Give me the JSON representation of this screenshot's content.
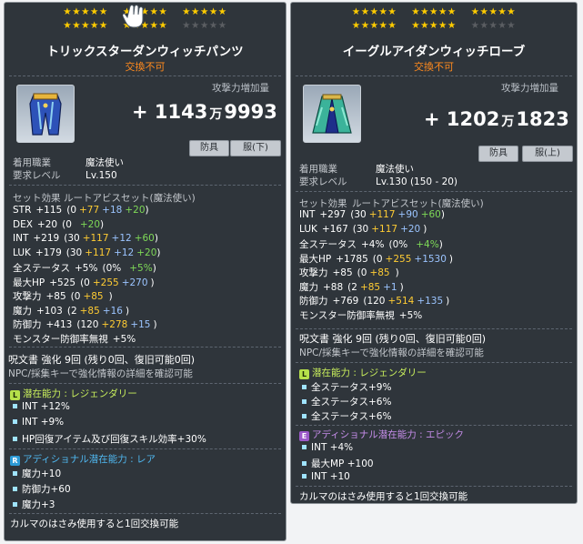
{
  "left": {
    "stars": {
      "row1": [
        "★★★★★",
        "★★★★★",
        "★★★★★"
      ],
      "row2": [
        "★★★★★",
        "★★★★★",
        "★★★★★"
      ]
    },
    "title": "トリックスターダンウィッチパンツ",
    "trade": "交換不可",
    "power_label": "攻撃力増加量",
    "power_prefix": "+ 1143",
    "power_unit": "万",
    "power_rest": "9993",
    "tags": [
      "防具",
      "服(下)"
    ],
    "job_label": "着用職業",
    "job_value": "魔法使い",
    "level_label": "要求レベル",
    "level_value": "Lv.150",
    "set_label": "セット効果",
    "set_value": "ルートアビスセット(魔法使い)",
    "stats": [
      {
        "k": "STR",
        "v": "+115",
        "base": "(0",
        "a": "+77",
        "b": "+18",
        "c": "+20",
        "end": ")"
      },
      {
        "k": "DEX",
        "v": "+20",
        "base": "(0",
        "a": "",
        "b": "",
        "c": "+20",
        "end": ")"
      },
      {
        "k": "INT",
        "v": "+219",
        "base": "(30",
        "a": "+117",
        "b": "+12",
        "c": "+60",
        "end": ")"
      },
      {
        "k": "LUK",
        "v": "+179",
        "base": "(30",
        "a": "+117",
        "b": "+12",
        "c": "+20",
        "end": ")"
      },
      {
        "k": "全ステータス",
        "v": "+5%",
        "base": "(0%",
        "a": "",
        "b": "",
        "c": "+5%",
        "end": ")"
      },
      {
        "k": "最大HP",
        "v": "+525",
        "base": "(0",
        "a": "+255",
        "b": "+270",
        "c": "",
        "end": ")"
      },
      {
        "k": "攻撃力",
        "v": "+85",
        "base": "(0",
        "a": "+85",
        "b": "",
        "c": "",
        "end": ")"
      },
      {
        "k": "魔力",
        "v": "+103",
        "base": "(2",
        "a": "+85",
        "b": "+16",
        "c": "",
        "end": ")"
      },
      {
        "k": "防御力",
        "v": "+413",
        "base": "(120",
        "a": "+278",
        "b": "+15",
        "c": "",
        "end": ")"
      },
      {
        "k": "モンスター防御率無視",
        "v": "+5%",
        "base": "",
        "a": "",
        "b": "",
        "c": "",
        "end": ""
      }
    ],
    "scroll_line": "呪文書 強化 9回 (残り0回、復旧可能0回)",
    "npc_line": "NPC/採集キーで強化情報の詳細を確認可能",
    "pot_head": "潜在能力 : レジェンダリー",
    "pot_icon": "L",
    "pot_lines": [
      "INT +12%",
      "INT +9%",
      "HP回復アイテム及び回復スキル効率+30%"
    ],
    "add_head": "アディショナル潜在能力 : レア",
    "add_icon": "R",
    "add_lines": [
      "魔力+10",
      "防御力+60",
      "魔力+3"
    ],
    "footer": "カルマのはさみ使用すると1回交換可能"
  },
  "right": {
    "stars": {
      "row1": [
        "★★★★★",
        "★★★★★",
        "★★★★★"
      ],
      "row2": [
        "★★★★★",
        "★★★★★",
        "★★★★★"
      ]
    },
    "title": "イーグルアイダンウィッチローブ",
    "trade": "交換不可",
    "power_label": "攻撃力増加量",
    "power_prefix": "+ 1202",
    "power_unit": "万",
    "power_rest": "1823",
    "tags": [
      "防具",
      "服(上)"
    ],
    "job_label": "着用職業",
    "job_value": "魔法使い",
    "level_label": "要求レベル",
    "level_value": "Lv.130 (150 - 20)",
    "set_label": "セット効果",
    "set_value": "ルートアビスセット(魔法使い)",
    "stats": [
      {
        "k": "INT",
        "v": "+297",
        "base": "(30",
        "a": "+117",
        "b": "+90",
        "c": "+60",
        "end": ")"
      },
      {
        "k": "LUK",
        "v": "+167",
        "base": "(30",
        "a": "+117",
        "b": "+20",
        "c": "",
        "end": ")"
      },
      {
        "k": "全ステータス",
        "v": "+4%",
        "base": "(0%",
        "a": "",
        "b": "",
        "c": "+4%",
        "end": ")"
      },
      {
        "k": "最大HP",
        "v": "+1785",
        "base": "(0",
        "a": "+255",
        "b": "+1530",
        "c": "",
        "end": ")"
      },
      {
        "k": "攻撃力",
        "v": "+85",
        "base": "(0",
        "a": "+85",
        "b": "",
        "c": "",
        "end": ")"
      },
      {
        "k": "魔力",
        "v": "+88",
        "base": "(2",
        "a": "+85",
        "b": "+1",
        "c": "",
        "end": ")"
      },
      {
        "k": "防御力",
        "v": "+769",
        "base": "(120",
        "a": "+514",
        "b": "+135",
        "c": "",
        "end": ")"
      },
      {
        "k": "モンスター防御率無視",
        "v": "+5%",
        "base": "",
        "a": "",
        "b": "",
        "c": "",
        "end": ""
      }
    ],
    "scroll_line": "呪文書 強化 9回 (残り0回、復旧可能0回)",
    "npc_line": "NPC/採集キーで強化情報の詳細を確認可能",
    "pot_head": "潜在能力 : レジェンダリー",
    "pot_icon": "L",
    "pot_lines": [
      "全ステータス+9%",
      "全ステータス+6%",
      "全ステータス+6%"
    ],
    "add_head": "アディショナル潜在能力 : エピック",
    "add_icon": "E",
    "add_lines": [
      "INT +4%",
      "最大MP +100",
      "INT +10"
    ],
    "footer": "カルマのはさみ使用すると1回交換可能"
  },
  "colors": {
    "panel_bg": "#22282f",
    "gold": "#ffcc00",
    "orange": "#ff8a1e",
    "legendary": "#b6e04a",
    "epic": "#9b59c9",
    "rare": "#2d9bd7"
  }
}
